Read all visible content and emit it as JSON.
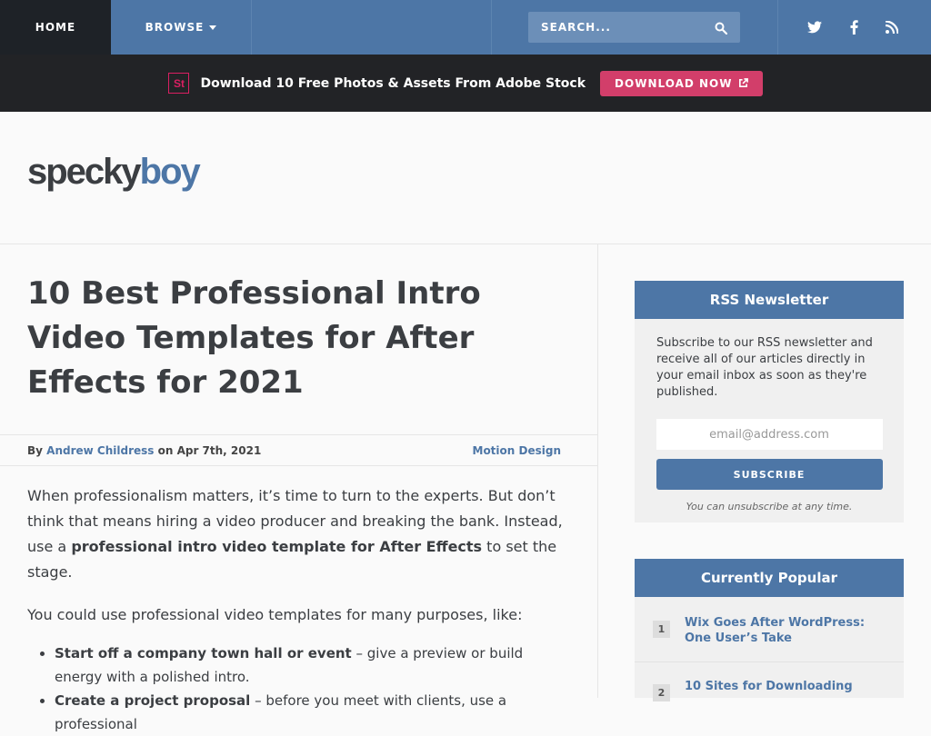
{
  "nav": {
    "home": "HOME",
    "browse": "BROWSE",
    "search_placeholder": "SEARCH...",
    "social": [
      "twitter-icon",
      "facebook-icon",
      "rss-icon"
    ]
  },
  "promo": {
    "logo_text": "St",
    "text": "Download 10 Free Photos & Assets From Adobe Stock",
    "button": "DOWNLOAD NOW"
  },
  "header": {
    "logo_part1": "specky",
    "logo_part2": "boy"
  },
  "article": {
    "title": "10 Best Professional Intro Video Templates for After Effects for 2021",
    "by": "By",
    "author": "Andrew Childress",
    "on": "on",
    "date": "Apr 7th, 2021",
    "category": "Motion Design",
    "p1_a": "When professionalism matters, it’s time to turn to the experts. But don’t think that means hiring a video producer and breaking the bank. Instead, use a",
    "p1_bold": "professional intro video template for After Effects",
    "p1_b": "to set the stage.",
    "p2": "You could use professional video templates for many purposes, like:",
    "li1_bold": "Start off a company town hall or event",
    "li1_text": "– give a preview or build energy with a polished intro.",
    "li2_bold": "Create a project proposal",
    "li2_text": "– before you meet with clients, use a professional"
  },
  "sidebar": {
    "rss": {
      "heading": "RSS Newsletter",
      "description": "Subscribe to our RSS newsletter and receive all of our articles directly in your email inbox as soon as they're published.",
      "email_placeholder": "email@address.com",
      "button": "SUBSCRIBE",
      "note": "You can unsubscribe at any time."
    },
    "popular": {
      "heading": "Currently Popular",
      "items": [
        {
          "num": "1",
          "title": "Wix Goes After WordPress: One User’s Take"
        },
        {
          "num": "2",
          "title": "10 Sites for Downloading"
        }
      ]
    }
  },
  "colors": {
    "brand_blue": "#4d76a6",
    "dark": "#1e2227",
    "promo_pink": "#d23e6a"
  }
}
